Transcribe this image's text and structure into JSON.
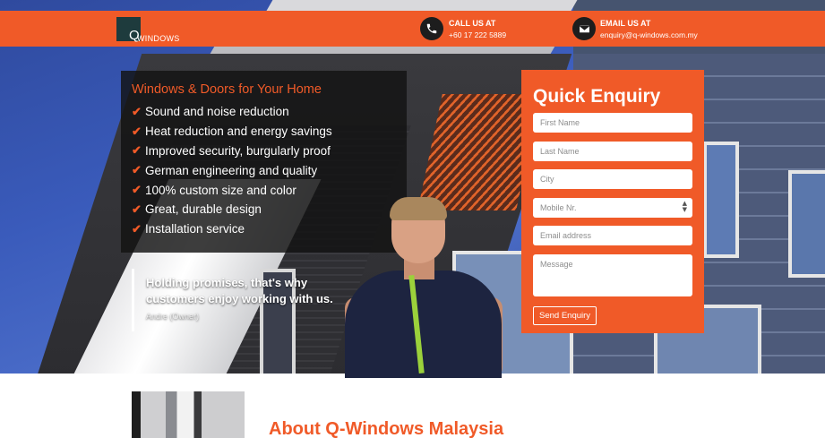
{
  "colors": {
    "brand": "#f05a28",
    "text_light": "#ffffff"
  },
  "header": {
    "logo_mark": "Q",
    "logo_text": "WINDOWS",
    "call": {
      "icon": "phone-icon",
      "label": "CALL US AT",
      "value": "+60 17 222 5889"
    },
    "email": {
      "icon": "envelope-icon",
      "label": "EMAIL US AT",
      "value": "enquiry@q-windows.com.my"
    }
  },
  "benefits": {
    "title": "Windows & Doors for Your Home",
    "items": [
      "Sound and noise reduction",
      "Heat reduction and energy savings",
      "Improved security, burgularly proof",
      "German engineering and quality",
      "100% custom size and color",
      "Great, durable design",
      "Installation service"
    ]
  },
  "quote": {
    "text": "Holding promises, that's why customers enjoy working with us.",
    "author": "Andre (Owner)"
  },
  "form": {
    "title": "Quick Enquiry",
    "first_name_placeholder": "First Name",
    "last_name_placeholder": "Last Name",
    "city_placeholder": "City",
    "mobile_placeholder": "Mobile Nr.",
    "email_placeholder": "Email address",
    "message_placeholder": "Message",
    "submit_label": "Send Enquiry"
  },
  "about": {
    "title": "About Q-Windows Malaysia"
  }
}
